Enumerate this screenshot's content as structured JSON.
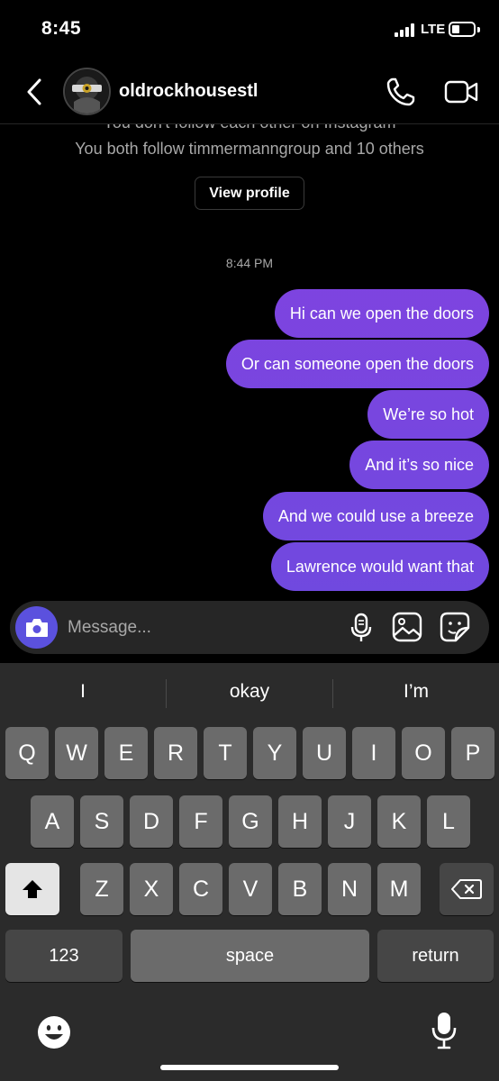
{
  "status_bar": {
    "time": "8:45",
    "network": "LTE",
    "battery_level": 0.35
  },
  "header": {
    "username": "oldrockhousestl",
    "avatar_text": "ROCK HOUSE",
    "back_icon": "chevron-left-icon",
    "call_icon": "phone-icon",
    "video_icon": "video-camera-icon"
  },
  "profile_summary": {
    "follow_status": "You don't follow each other on Instagram",
    "mutual_followers": "You both follow timmermanngroup and 10 others",
    "view_profile_label": "View profile"
  },
  "thread": {
    "timestamp": "8:44 PM",
    "messages": [
      {
        "text": "Hi can we open the doors",
        "sender": "me"
      },
      {
        "text": "Or can someone open the doors",
        "sender": "me"
      },
      {
        "text": "We’re so hot",
        "sender": "me"
      },
      {
        "text": "And it’s so nice",
        "sender": "me"
      },
      {
        "text": "And we could use a breeze",
        "sender": "me"
      },
      {
        "text": "Lawrence would want that",
        "sender": "me"
      }
    ]
  },
  "composer": {
    "placeholder": "Message...",
    "icons": [
      "camera-icon",
      "microphone-icon",
      "gallery-icon",
      "sticker-icon"
    ]
  },
  "keyboard": {
    "suggestions": [
      "I",
      "okay",
      "I’m"
    ],
    "row1": [
      "Q",
      "W",
      "E",
      "R",
      "T",
      "Y",
      "U",
      "I",
      "O",
      "P"
    ],
    "row2": [
      "A",
      "S",
      "D",
      "F",
      "G",
      "H",
      "J",
      "K",
      "L"
    ],
    "row3": [
      "Z",
      "X",
      "C",
      "V",
      "B",
      "N",
      "M"
    ],
    "numbers_label": "123",
    "space_label": "space",
    "return_label": "return"
  },
  "colors": {
    "background": "#000000",
    "bubble_gradient": [
      "#8a3fe0",
      "#5b51de"
    ],
    "composer_bg": "#262626",
    "keyboard_bg": "#2b2b2b",
    "key_bg": "#6b6b6b",
    "func_key_bg": "#464646",
    "secondary_text": "#a8a8a8"
  }
}
